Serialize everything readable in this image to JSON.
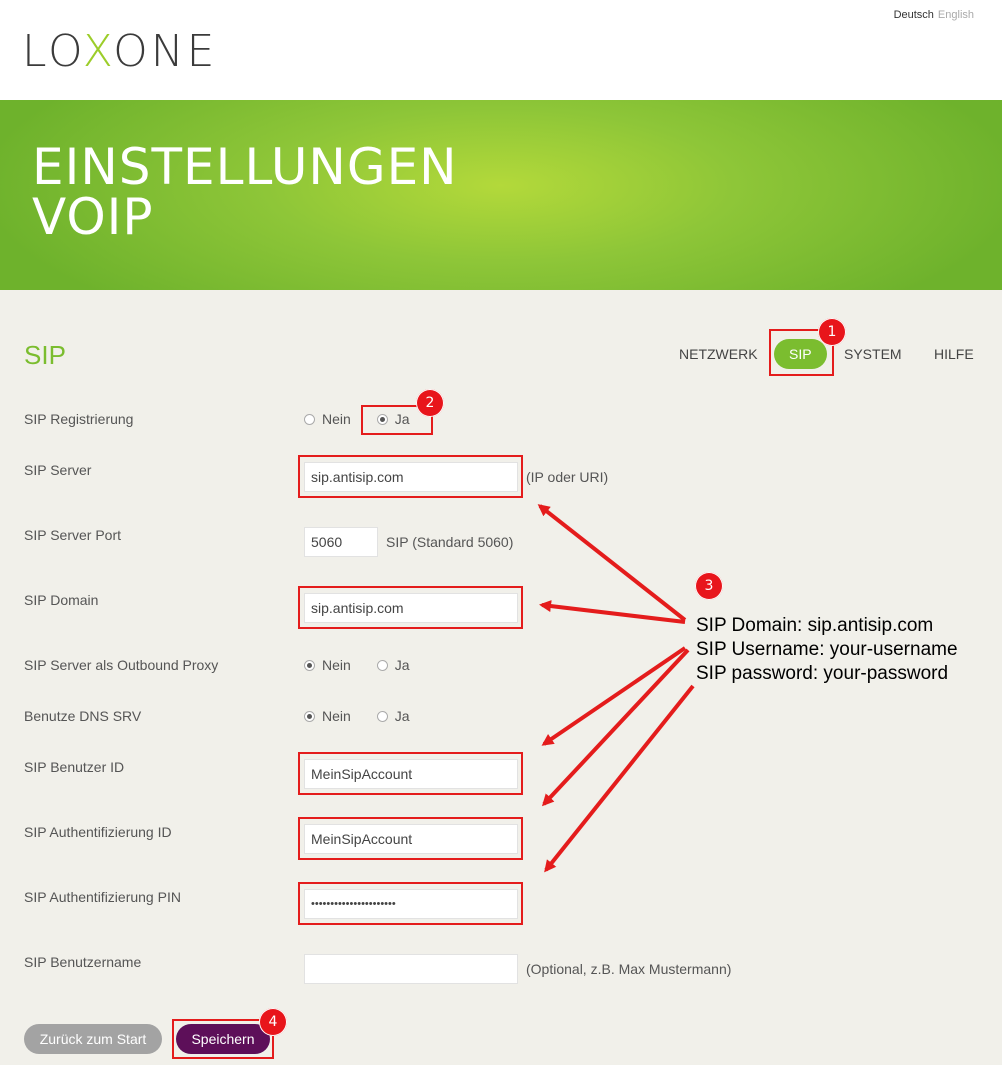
{
  "lang": {
    "de": "Deutsch",
    "en": "English"
  },
  "logo": {
    "pre": "LO",
    "x": "X",
    "post": "ONE"
  },
  "banner": {
    "line1": "EINSTELLUNGEN",
    "line2": "VOIP"
  },
  "section_title": "SIP",
  "nav": {
    "netzwerk": "NETZWERK",
    "sip": "SIP",
    "system": "SYSTEM",
    "hilfe": "HILFE"
  },
  "form": {
    "registrierung": {
      "label": "SIP Registrierung",
      "no": "Nein",
      "yes": "Ja",
      "selected": "Ja"
    },
    "server": {
      "label": "SIP Server",
      "value": "sip.antisip.com",
      "hint": "(IP oder URI)"
    },
    "port": {
      "label": "SIP Server Port",
      "value": "5060",
      "hint": "SIP (Standard 5060)"
    },
    "domain": {
      "label": "SIP Domain",
      "value": "sip.antisip.com"
    },
    "outbound": {
      "label": "SIP Server als Outbound Proxy",
      "no": "Nein",
      "yes": "Ja",
      "selected": "Nein"
    },
    "dns": {
      "label": "Benutze DNS SRV",
      "no": "Nein",
      "yes": "Ja",
      "selected": "Nein"
    },
    "user_id": {
      "label": "SIP Benutzer ID",
      "value": "MeinSipAccount"
    },
    "auth_id": {
      "label": "SIP Authentifizierung ID",
      "value": "MeinSipAccount"
    },
    "pin": {
      "label": "SIP Authentifizierung PIN",
      "value": "••••••••••••••••••••••"
    },
    "username": {
      "label": "SIP Benutzername",
      "value": "",
      "hint": "(Optional, z.B. Max Mustermann)"
    }
  },
  "buttons": {
    "back": "Zurück zum Start",
    "save": "Speichern"
  },
  "badges": {
    "b1": "1",
    "b2": "2",
    "b3": "3",
    "b4": "4"
  },
  "note": {
    "line1": "SIP Domain: sip.antisip.com",
    "line2": "SIP Username: your-username",
    "line3": "SIP password: your-password"
  },
  "colors": {
    "brand_green": "#7bbd2f",
    "save_purple": "#5d0f59",
    "annotation_red": "#e41c1c"
  }
}
